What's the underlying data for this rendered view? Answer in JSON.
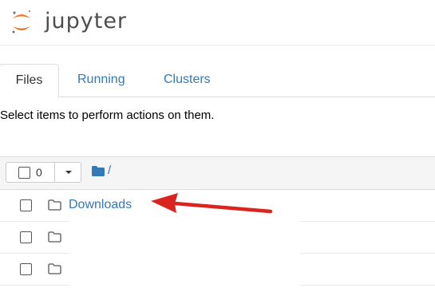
{
  "app": {
    "title": "jupyter",
    "logo_icon": "jupyter-logo-icon"
  },
  "tabs": [
    {
      "label": "Files",
      "active": true
    },
    {
      "label": "Running",
      "active": false
    },
    {
      "label": "Clusters",
      "active": false
    }
  ],
  "instructions": "Select items to perform actions on them.",
  "toolbar": {
    "selected_count": "0",
    "breadcrumb_root": "/"
  },
  "files": [
    {
      "name": "Downloads",
      "type": "folder",
      "icon": "folder-icon"
    },
    {
      "name": "",
      "type": "folder",
      "icon": "folder-icon"
    },
    {
      "name": "",
      "type": "folder",
      "icon": "folder-icon"
    }
  ],
  "annotation": {
    "icon": "red-arrow-icon",
    "color": "#d9241f"
  },
  "colors": {
    "link": "#337ab7",
    "logo_orange": "#f37726",
    "header_bg": "#f5f5f5"
  }
}
